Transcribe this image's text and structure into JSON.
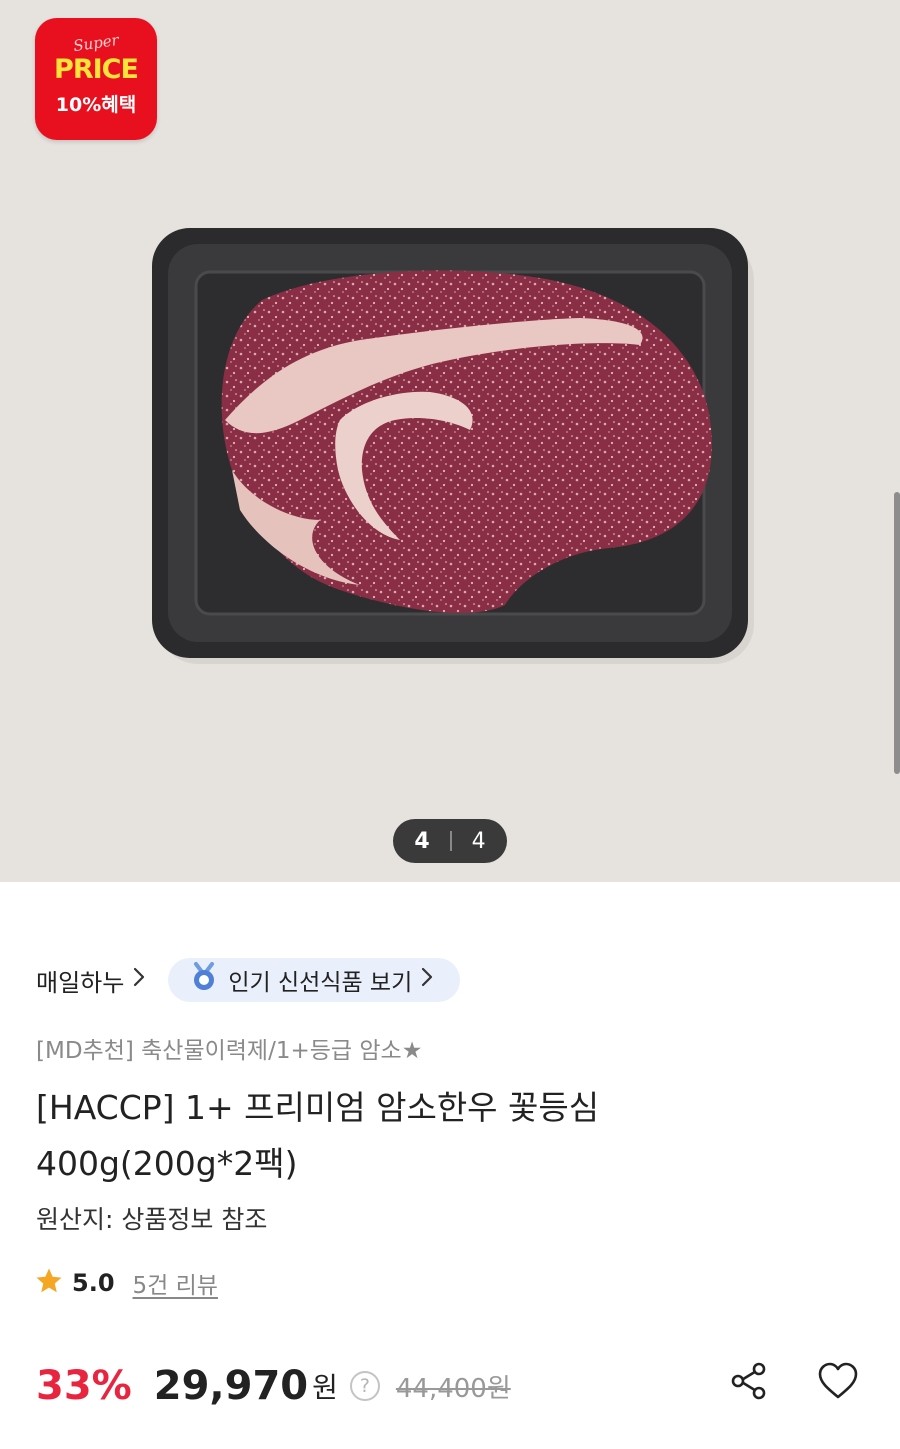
{
  "badge": {
    "super": "Super",
    "price": "PRICE",
    "benefit": "10%혜택"
  },
  "gallery": {
    "current": "4",
    "total": "4"
  },
  "seller": {
    "name": "매일하누",
    "chip_label": "인기 신선식품 보기"
  },
  "product": {
    "subtitle": "[MD추천] 축산물이력제/1+등급 암소★",
    "title_line1": "[HACCP] 1+ 프리미엄 암소한우 꽃등심",
    "title_line2": "400g(200g*2팩)",
    "origin": "원산지: 상품정보 참조"
  },
  "rating": {
    "score": "5.0",
    "reviews": "5건 리뷰"
  },
  "price": {
    "discount": "33%",
    "sale": "29,970",
    "won": "원",
    "help": "?",
    "original": "44,400원"
  },
  "icons": {
    "share": "share-icon",
    "heart": "heart-icon",
    "star": "star-icon",
    "chevron": "chevron-right-icon",
    "medal": "medal-icon"
  },
  "colors": {
    "accent_red": "#e8243f",
    "badge_red": "#e8101f",
    "chip_bg": "#eaf0fb"
  }
}
